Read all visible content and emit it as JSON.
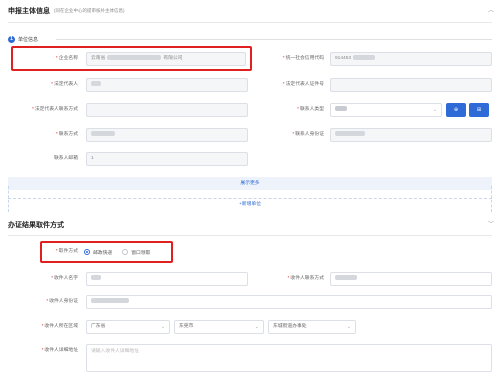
{
  "section1": {
    "title": "申报主体信息",
    "subtitle": "(同在企业中心的提审核补主体信息)",
    "subsection": "单位信息",
    "subsection_index": "1",
    "company_name": {
      "label": "企业名称",
      "value": "云南省",
      "value_suffix": "有限公司"
    },
    "credit_code": {
      "label": "统一社会信用代码",
      "value": "914453"
    },
    "legal_rep": {
      "label": "法定代表人"
    },
    "legal_rep_id": {
      "label": "法定代表人证件号"
    },
    "legal_rep_phone": {
      "label": "法定代表人联系方式"
    },
    "contact_type": {
      "label": "联系人类型",
      "btn1": "⊕",
      "btn2": "⊞"
    },
    "contact_name": {
      "label": "联系方式"
    },
    "contact_id": {
      "label": "联系人身份证"
    },
    "contact_email": {
      "label": "联系人邮箱",
      "value": "1"
    },
    "show_more": "展示更多",
    "add_unit": "+新增单位"
  },
  "section2": {
    "title": "办证结果取件方式",
    "pickup_label": "取件方式",
    "options": [
      "邮政快递",
      "窗口领取"
    ],
    "selected": 0,
    "recipient_name": {
      "label": "收件人名字"
    },
    "recipient_phone": {
      "label": "收件人联系方式"
    },
    "recipient_id": {
      "label": "收件人身份证"
    },
    "region": {
      "label": "收件人所在区域",
      "province": "广东省",
      "city": "东莞市",
      "district": "东城街道办事处"
    },
    "address": {
      "label": "收件人详细地址",
      "placeholder": "请输入收件人详细地址"
    }
  }
}
